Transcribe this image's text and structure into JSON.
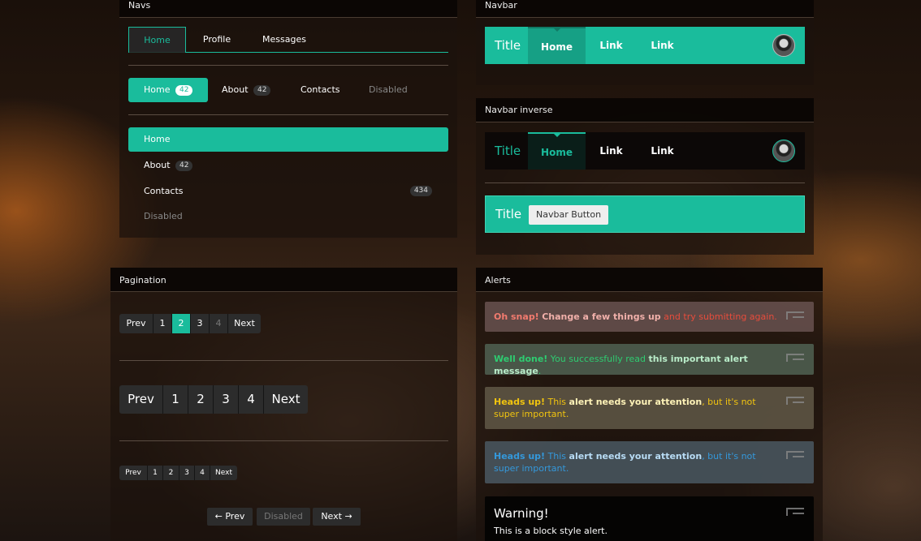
{
  "navs": {
    "title": "Navs",
    "tabs": [
      {
        "label": "Home",
        "active": true
      },
      {
        "label": "Profile"
      },
      {
        "label": "Messages"
      }
    ],
    "pills": [
      {
        "label": "Home",
        "badge": "42"
      },
      {
        "label": "About",
        "badge": "42"
      },
      {
        "label": "Contacts"
      },
      {
        "label": "Disabled"
      }
    ],
    "stacked": [
      {
        "label": "Home"
      },
      {
        "label": "About",
        "badge": "42"
      },
      {
        "label": "Contacts",
        "badge": "434"
      },
      {
        "label": "Disabled"
      }
    ]
  },
  "navbar": {
    "title": "Navbar",
    "brand": "Title",
    "items": [
      "Home",
      "Link",
      "Link"
    ]
  },
  "navbar_inverse": {
    "title": "Navbar inverse",
    "brand": "Title",
    "items": [
      "Home",
      "Link",
      "Link"
    ],
    "brand2": "Title",
    "button_label": "Navbar Button"
  },
  "pagination": {
    "title": "Pagination",
    "default": [
      "Prev",
      "1",
      "2",
      "3",
      "4",
      "Next"
    ],
    "large": [
      "Prev",
      "1",
      "2",
      "3",
      "4",
      "Next"
    ],
    "small": [
      "Prev",
      "1",
      "2",
      "3",
      "4",
      "Next"
    ],
    "pager": {
      "prev": "← Prev",
      "disabled": "Disabled",
      "next": "Next →"
    }
  },
  "alerts": {
    "title": "Alerts",
    "error": {
      "strong": "Oh snap!",
      "mid": "Change a few things up",
      "rest": " and try submitting again."
    },
    "success": {
      "strong": "Well done!",
      "text": " You successfully read ",
      "mid": "this important alert message",
      "rest": "."
    },
    "warning": {
      "strong": "Heads up!",
      "text": " This ",
      "mid": "alert needs your attention",
      "rest": ", but it's not super important."
    },
    "info": {
      "strong": "Heads up!",
      "text": " This ",
      "mid": "alert needs your attention",
      "rest": ", but it's not super important."
    },
    "block": {
      "title": "Warning!",
      "text": "This is a block style alert."
    }
  },
  "colors": {
    "accent": "#1abc9c",
    "accent_dark": "#16a085",
    "error": "#e74c3c",
    "success": "#2ecc71",
    "warning": "#f1c40f",
    "info": "#3498db"
  }
}
